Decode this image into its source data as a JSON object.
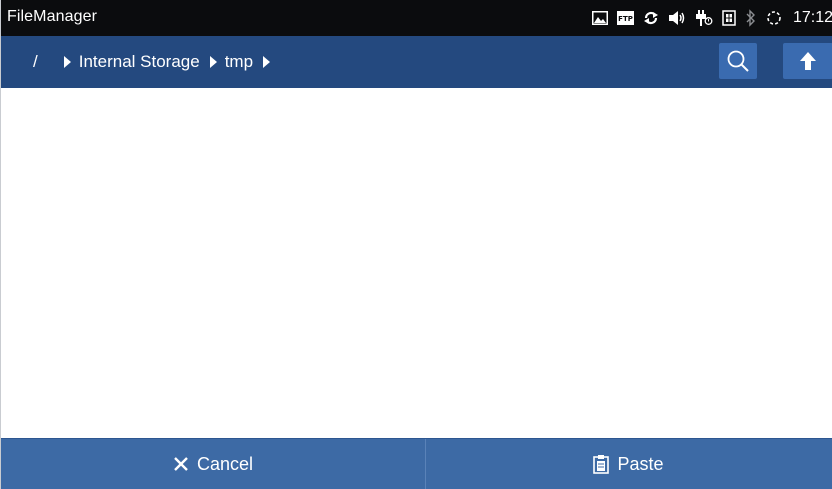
{
  "status_bar": {
    "app_title": "FileManager",
    "time": "17:12",
    "icons": [
      "image-icon",
      "ftp-icon",
      "sync-icon",
      "volume-icon",
      "usb-icon",
      "sim-card-icon",
      "bluetooth-icon",
      "loading-icon"
    ],
    "ftp_label": "FTP"
  },
  "breadcrumb": {
    "root": "/",
    "items": [
      "Internal Storage",
      "tmp"
    ]
  },
  "toolbar": {
    "buttons": [
      "search-icon",
      "up-arrow-icon"
    ],
    "accent": "#3a6bb0",
    "background": "#24497f"
  },
  "action_bar": {
    "cancel_label": "Cancel",
    "paste_label": "Paste",
    "background": "#3d6aa5"
  }
}
